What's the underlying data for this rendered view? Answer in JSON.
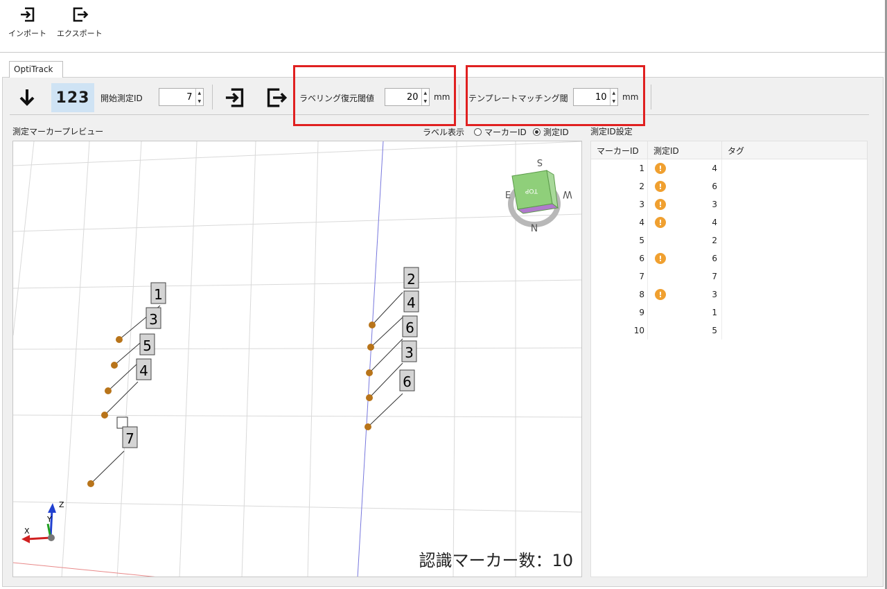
{
  "toolbar": {
    "import_label": "インポート",
    "export_label": "エクスポート"
  },
  "tab": {
    "label": "OptiTrack"
  },
  "inner_toolbar": {
    "numbering_label": "123",
    "start_id_label": "開始測定ID",
    "start_id_value": "7",
    "relabel_label": "ラベリング復元閾値",
    "relabel_value": "20",
    "relabel_unit": "mm",
    "template_label": "テンプレートマッチング閾値",
    "template_value": "10",
    "template_unit": "mm"
  },
  "preview": {
    "title": "測定マーカープレビュー",
    "label_display": "ラベル表示",
    "radio_marker": "マーカーID",
    "radio_measure": "測定ID",
    "selected": "測定ID",
    "count_text": "認識マーカー数：10",
    "axis_x": "X",
    "axis_y": "Y",
    "axis_z": "Z",
    "cube_top": "TOP",
    "compass_n": "N",
    "compass_e": "E",
    "compass_w": "W",
    "compass_s": "S",
    "marker_labels": [
      "1",
      "3",
      "5",
      "4",
      "7",
      "2",
      "4",
      "6",
      "3",
      "6"
    ]
  },
  "id_settings": {
    "title": "測定ID設定",
    "headers": [
      "マーカーID",
      "測定ID",
      "タグ"
    ],
    "rows": [
      {
        "marker_id": "1",
        "measure_id": "4",
        "warn": true,
        "tag": ""
      },
      {
        "marker_id": "2",
        "measure_id": "6",
        "warn": true,
        "tag": ""
      },
      {
        "marker_id": "3",
        "measure_id": "3",
        "warn": true,
        "tag": ""
      },
      {
        "marker_id": "4",
        "measure_id": "4",
        "warn": true,
        "tag": ""
      },
      {
        "marker_id": "5",
        "measure_id": "2",
        "warn": false,
        "tag": ""
      },
      {
        "marker_id": "6",
        "measure_id": "6",
        "warn": true,
        "tag": ""
      },
      {
        "marker_id": "7",
        "measure_id": "7",
        "warn": false,
        "tag": ""
      },
      {
        "marker_id": "8",
        "measure_id": "3",
        "warn": true,
        "tag": ""
      },
      {
        "marker_id": "9",
        "measure_id": "1",
        "warn": false,
        "tag": ""
      },
      {
        "marker_id": "10",
        "measure_id": "5",
        "warn": false,
        "tag": ""
      }
    ]
  },
  "colors": {
    "accent_highlight": "#cfe3f4",
    "warning": "#f0a030",
    "annotation_red": "#e02020",
    "marker_ball": "#b8741a"
  }
}
